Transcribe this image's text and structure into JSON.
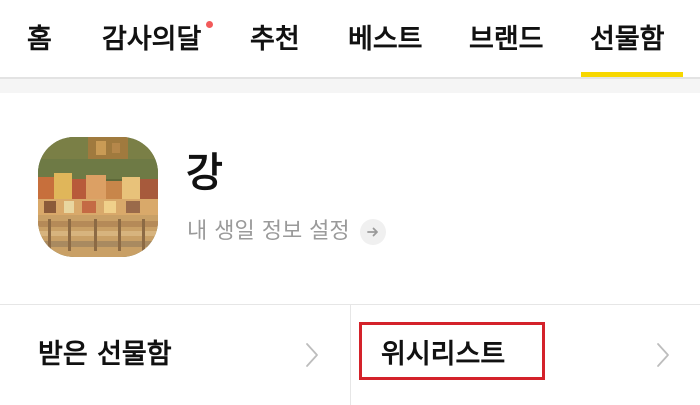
{
  "tabs": [
    {
      "label": "홈"
    },
    {
      "label": "감사의달"
    },
    {
      "label": "추천"
    },
    {
      "label": "베스트"
    },
    {
      "label": "브랜드"
    },
    {
      "label": "선물함"
    }
  ],
  "active_tab": "선물함",
  "colors": {
    "accent_underline": "#f7d700",
    "notification_dot": "#f25a5a",
    "highlight_box": "#d4222a"
  },
  "profile": {
    "name": "강",
    "birthday_link_label": "내 생일 정보 설정",
    "avatar_icon": "profile-photo-painting"
  },
  "menu": {
    "received_gifts_label": "받은 선물함",
    "wishlist_label": "위시리스트"
  }
}
